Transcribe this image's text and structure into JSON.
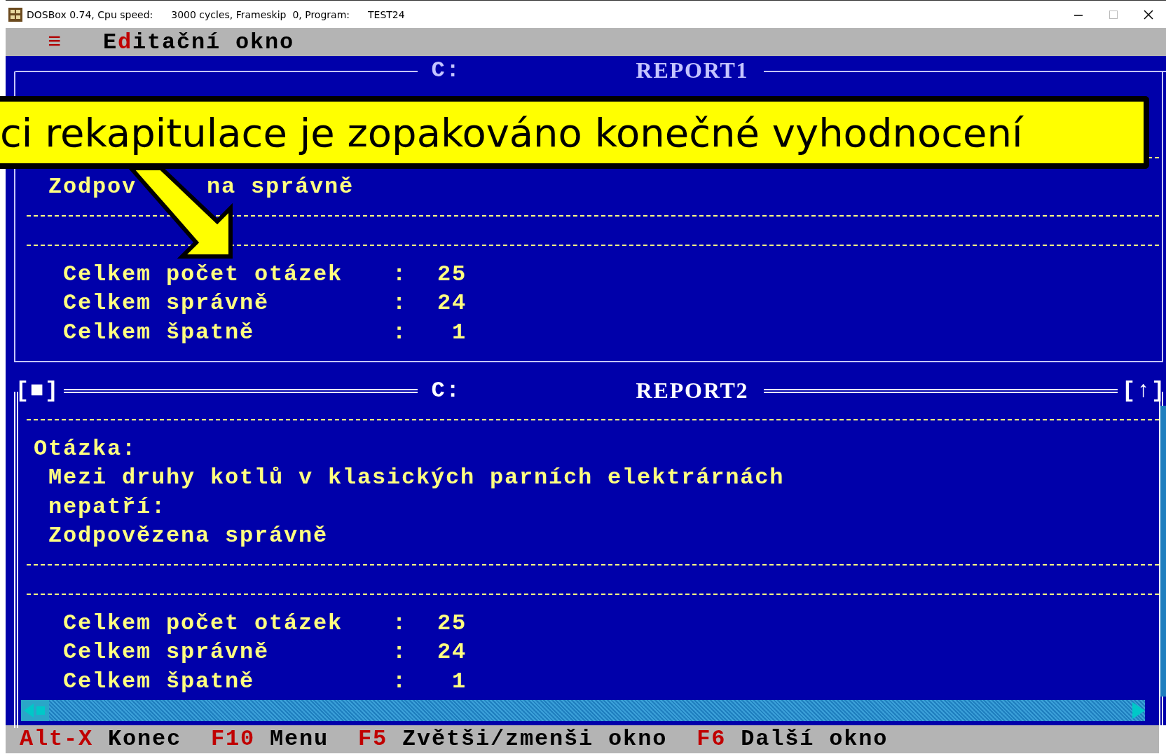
{
  "window": {
    "title_parts": [
      "DOSBox 0.74, Cpu speed:",
      "3000 cycles, Frameskip  0, Program:",
      "TEST24"
    ]
  },
  "menu_bar": {
    "menu_glyph": "≡",
    "title": [
      {
        "text": "E",
        "hotkey": false
      },
      {
        "text": "d",
        "hotkey": true
      },
      {
        "text": "itační okno",
        "hotkey": false
      }
    ]
  },
  "windows": [
    {
      "drive": "C:",
      "name": "REPORT1",
      "active": false,
      "lines": [
        {
          "kind": "text",
          "parts": [
            "Zodpov",
            "na správně"
          ]
        }
      ],
      "summary": [
        {
          "label": "Celkem počet otázek",
          "sep": ":",
          "value": "25"
        },
        {
          "label": "Celkem správně",
          "sep": ":",
          "value": "24"
        },
        {
          "label": "Celkem špatně",
          "sep": ":",
          "value": "1"
        }
      ]
    },
    {
      "drive": "C:",
      "name": "REPORT2",
      "active": true,
      "close_button": "[■]",
      "zoom_button": "[↑]",
      "lines": [
        {
          "kind": "heading",
          "parts": [
            "Otázka:"
          ]
        },
        {
          "kind": "text",
          "parts": [
            "Mezi druhy kotlů v klasických parních elektrárnách"
          ]
        },
        {
          "kind": "text",
          "parts": [
            "nepatří:"
          ]
        },
        {
          "kind": "text",
          "parts": [
            "Zodpovězena správně"
          ]
        }
      ],
      "summary": [
        {
          "label": "Celkem počet otázek",
          "sep": ":",
          "value": "25"
        },
        {
          "label": "Celkem správně",
          "sep": ":",
          "value": "24"
        },
        {
          "label": "Celkem špatně",
          "sep": ":",
          "value": "1"
        }
      ]
    }
  ],
  "status_bar": [
    {
      "key": "Alt-X",
      "label": "Konec"
    },
    {
      "key": "F10",
      "label": "Menu"
    },
    {
      "key": "F5",
      "label": "Zvětši/zmenši okno"
    },
    {
      "key": "F6",
      "label": "Další okno"
    }
  ],
  "callout": {
    "text": "ci rekapitulace je zopakováno konečné vyhodnocení"
  }
}
